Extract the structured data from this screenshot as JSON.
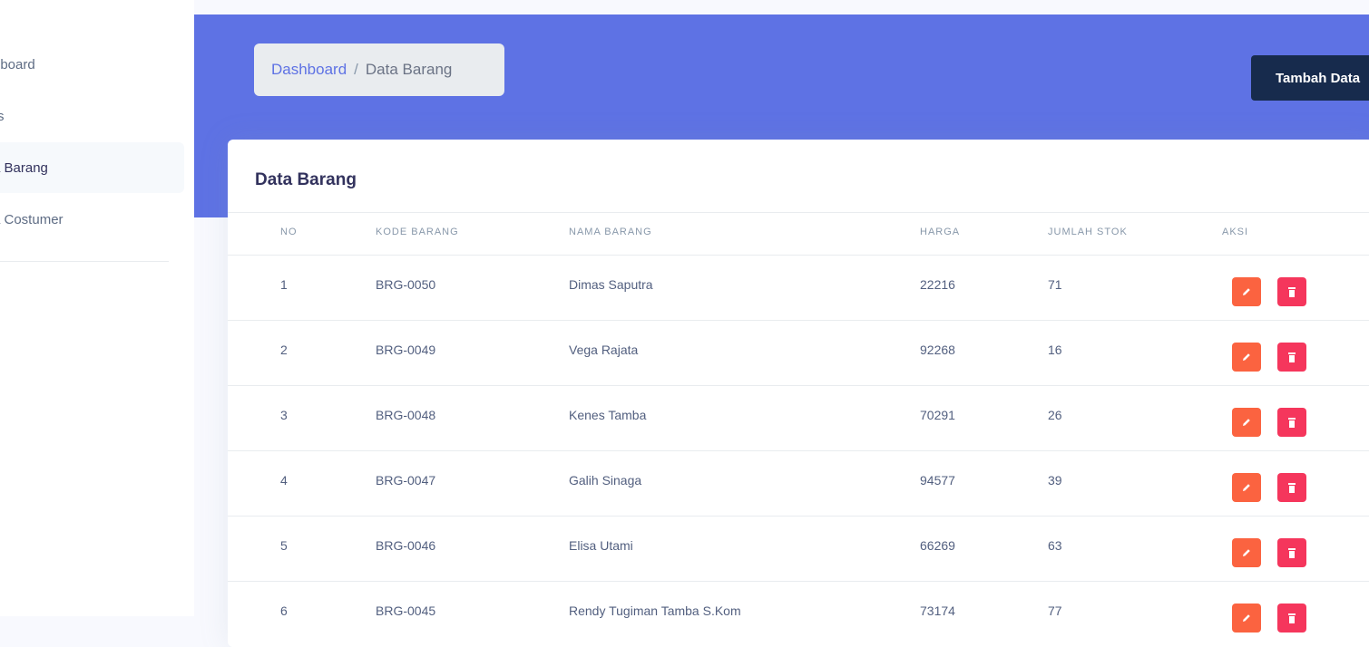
{
  "sidebar": {
    "items": [
      {
        "label": "hboard",
        "active": false
      },
      {
        "label": "rs",
        "active": false
      },
      {
        "label": "a Barang",
        "active": true
      },
      {
        "label": "a Costumer",
        "active": false
      }
    ]
  },
  "breadcrumb": {
    "home": "Dashboard",
    "separator": "/",
    "current": "Data Barang"
  },
  "header": {
    "add_button": "Tambah Data"
  },
  "card": {
    "title": "Data Barang"
  },
  "table": {
    "headers": [
      "NO",
      "KODE BARANG",
      "NAMA BARANG",
      "HARGA",
      "JUMLAH STOK",
      "AKSI"
    ],
    "rows": [
      {
        "no": "1",
        "kode": "BRG-0050",
        "nama": "Dimas Saputra",
        "harga": "22216",
        "stok": "71"
      },
      {
        "no": "2",
        "kode": "BRG-0049",
        "nama": "Vega Rajata",
        "harga": "92268",
        "stok": "16"
      },
      {
        "no": "3",
        "kode": "BRG-0048",
        "nama": "Kenes Tamba",
        "harga": "70291",
        "stok": "26"
      },
      {
        "no": "4",
        "kode": "BRG-0047",
        "nama": "Galih Sinaga",
        "harga": "94577",
        "stok": "39"
      },
      {
        "no": "5",
        "kode": "BRG-0046",
        "nama": "Elisa Utami",
        "harga": "66269",
        "stok": "63"
      },
      {
        "no": "6",
        "kode": "BRG-0045",
        "nama": "Rendy Tugiman Tamba S.Kom",
        "harga": "73174",
        "stok": "77"
      }
    ]
  },
  "colors": {
    "primary": "#5e72e4",
    "dark": "#172b4d",
    "edit": "#fb6340",
    "delete": "#f5365c"
  }
}
